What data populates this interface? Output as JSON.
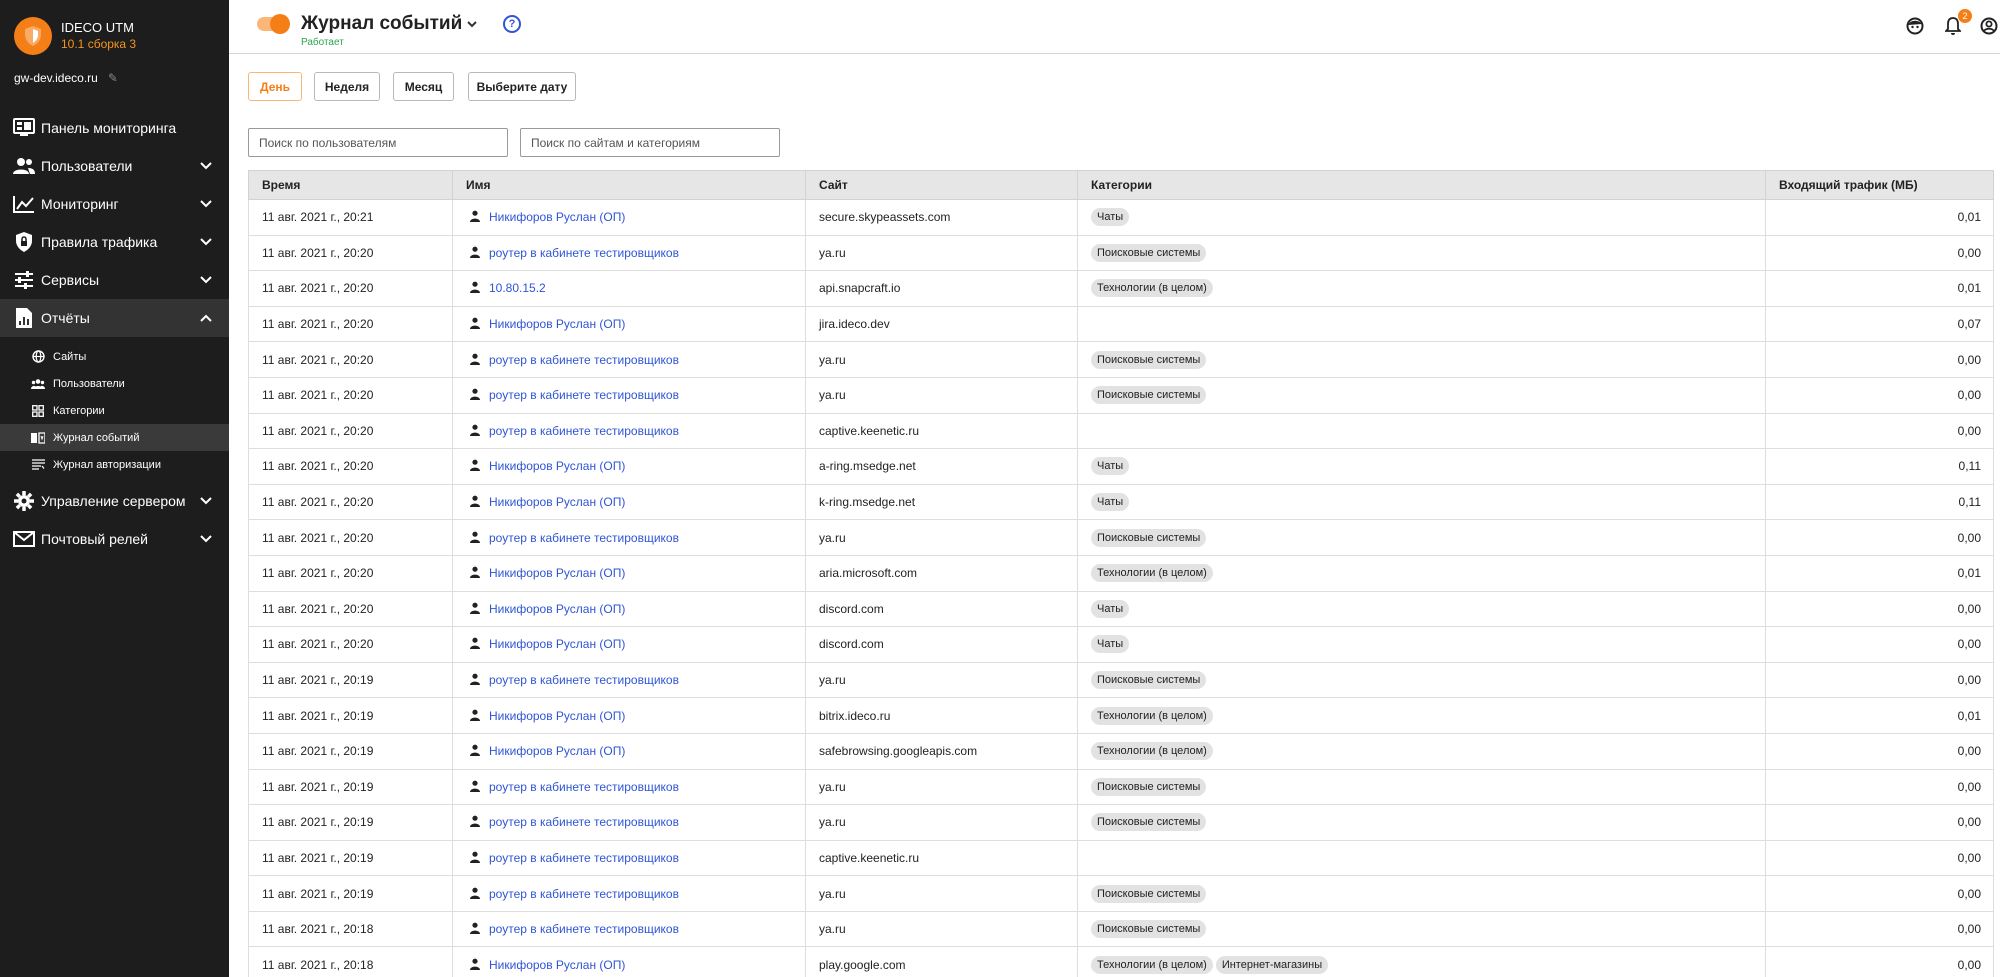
{
  "sidebar": {
    "brand": {
      "name": "IDECO UTM",
      "version": "10.1 сборка 3"
    },
    "host": "gw-dev.ideco.ru",
    "nav": [
      {
        "label": "Панель мониторинга",
        "icon": "monitor-dashboard-icon"
      },
      {
        "label": "Пользователи",
        "icon": "users-icon"
      },
      {
        "label": "Мониторинг",
        "icon": "chart-line-icon"
      },
      {
        "label": "Правила трафика",
        "icon": "shield-lock-icon"
      },
      {
        "label": "Сервисы",
        "icon": "sliders-icon"
      },
      {
        "label": "Отчёты",
        "icon": "report-icon"
      }
    ],
    "reports_sub": [
      {
        "label": "Сайты",
        "icon": "globe-icon"
      },
      {
        "label": "Пользователи",
        "icon": "users-icon"
      },
      {
        "label": "Категории",
        "icon": "grid-icon"
      },
      {
        "label": "Журнал событий",
        "icon": "book-icon"
      },
      {
        "label": "Журнал авторизации",
        "icon": "list-icon"
      }
    ],
    "nav_bottom": [
      {
        "label": "Управление сервером",
        "icon": "gear-icon"
      },
      {
        "label": "Почтовый релей",
        "icon": "mail-icon"
      }
    ]
  },
  "header": {
    "title": "Журнал событий",
    "status": "Работает",
    "help": "?",
    "notifications_count": "2"
  },
  "filters": {
    "day": "День",
    "week": "Неделя",
    "month": "Месяц",
    "choose_date": "Выберите дату",
    "search_users_placeholder": "Поиск по пользователям",
    "search_sites_placeholder": "Поиск по сайтам и категориям"
  },
  "table": {
    "columns": [
      "Время",
      "Имя",
      "Сайт",
      "Категории",
      "Входящий трафик (МБ)"
    ],
    "rows": [
      {
        "time": "11 авг. 2021 г., 20:21",
        "name": "Никифоров Руслан (ОП)",
        "site": "secure.skypeassets.com",
        "categories": [
          "Чаты"
        ],
        "traffic": "0,01"
      },
      {
        "time": "11 авг. 2021 г., 20:20",
        "name": "роутер в кабинете тестировщиков",
        "site": "ya.ru",
        "categories": [
          "Поисковые системы"
        ],
        "traffic": "0,00"
      },
      {
        "time": "11 авг. 2021 г., 20:20",
        "name": "10.80.15.2",
        "site": "api.snapcraft.io",
        "categories": [
          "Технологии (в целом)"
        ],
        "traffic": "0,01"
      },
      {
        "time": "11 авг. 2021 г., 20:20",
        "name": "Никифоров Руслан (ОП)",
        "site": "jira.ideco.dev",
        "categories": [],
        "traffic": "0,07"
      },
      {
        "time": "11 авг. 2021 г., 20:20",
        "name": "роутер в кабинете тестировщиков",
        "site": "ya.ru",
        "categories": [
          "Поисковые системы"
        ],
        "traffic": "0,00"
      },
      {
        "time": "11 авг. 2021 г., 20:20",
        "name": "роутер в кабинете тестировщиков",
        "site": "ya.ru",
        "categories": [
          "Поисковые системы"
        ],
        "traffic": "0,00"
      },
      {
        "time": "11 авг. 2021 г., 20:20",
        "name": "роутер в кабинете тестировщиков",
        "site": "captive.keenetic.ru",
        "categories": [],
        "traffic": "0,00"
      },
      {
        "time": "11 авг. 2021 г., 20:20",
        "name": "Никифоров Руслан (ОП)",
        "site": "a-ring.msedge.net",
        "categories": [
          "Чаты"
        ],
        "traffic": "0,11"
      },
      {
        "time": "11 авг. 2021 г., 20:20",
        "name": "Никифоров Руслан (ОП)",
        "site": "k-ring.msedge.net",
        "categories": [
          "Чаты"
        ],
        "traffic": "0,11"
      },
      {
        "time": "11 авг. 2021 г., 20:20",
        "name": "роутер в кабинете тестировщиков",
        "site": "ya.ru",
        "categories": [
          "Поисковые системы"
        ],
        "traffic": "0,00"
      },
      {
        "time": "11 авг. 2021 г., 20:20",
        "name": "Никифоров Руслан (ОП)",
        "site": "aria.microsoft.com",
        "categories": [
          "Технологии (в целом)"
        ],
        "traffic": "0,01"
      },
      {
        "time": "11 авг. 2021 г., 20:20",
        "name": "Никифоров Руслан (ОП)",
        "site": "discord.com",
        "categories": [
          "Чаты"
        ],
        "traffic": "0,00"
      },
      {
        "time": "11 авг. 2021 г., 20:20",
        "name": "Никифоров Руслан (ОП)",
        "site": "discord.com",
        "categories": [
          "Чаты"
        ],
        "traffic": "0,00"
      },
      {
        "time": "11 авг. 2021 г., 20:19",
        "name": "роутер в кабинете тестировщиков",
        "site": "ya.ru",
        "categories": [
          "Поисковые системы"
        ],
        "traffic": "0,00"
      },
      {
        "time": "11 авг. 2021 г., 20:19",
        "name": "Никифоров Руслан (ОП)",
        "site": "bitrix.ideco.ru",
        "categories": [
          "Технологии (в целом)"
        ],
        "traffic": "0,01"
      },
      {
        "time": "11 авг. 2021 г., 20:19",
        "name": "Никифоров Руслан (ОП)",
        "site": "safebrowsing.googleapis.com",
        "categories": [
          "Технологии (в целом)"
        ],
        "traffic": "0,00"
      },
      {
        "time": "11 авг. 2021 г., 20:19",
        "name": "роутер в кабинете тестировщиков",
        "site": "ya.ru",
        "categories": [
          "Поисковые системы"
        ],
        "traffic": "0,00"
      },
      {
        "time": "11 авг. 2021 г., 20:19",
        "name": "роутер в кабинете тестировщиков",
        "site": "ya.ru",
        "categories": [
          "Поисковые системы"
        ],
        "traffic": "0,00"
      },
      {
        "time": "11 авг. 2021 г., 20:19",
        "name": "роутер в кабинете тестировщиков",
        "site": "captive.keenetic.ru",
        "categories": [],
        "traffic": "0,00"
      },
      {
        "time": "11 авг. 2021 г., 20:19",
        "name": "роутер в кабинете тестировщиков",
        "site": "ya.ru",
        "categories": [
          "Поисковые системы"
        ],
        "traffic": "0,00"
      },
      {
        "time": "11 авг. 2021 г., 20:18",
        "name": "роутер в кабинете тестировщиков",
        "site": "ya.ru",
        "categories": [
          "Поисковые системы"
        ],
        "traffic": "0,00"
      },
      {
        "time": "11 авг. 2021 г., 20:18",
        "name": "Никифоров Руслан (ОП)",
        "site": "play.google.com",
        "categories": [
          "Технологии (в целом)",
          "Интернет-магазины"
        ],
        "traffic": "0,00"
      }
    ]
  },
  "colors": {
    "accent": "#f47f16",
    "link": "#2f55d4",
    "sidebar_bg": "#1d1d1d",
    "status_ok": "#2da44e"
  }
}
